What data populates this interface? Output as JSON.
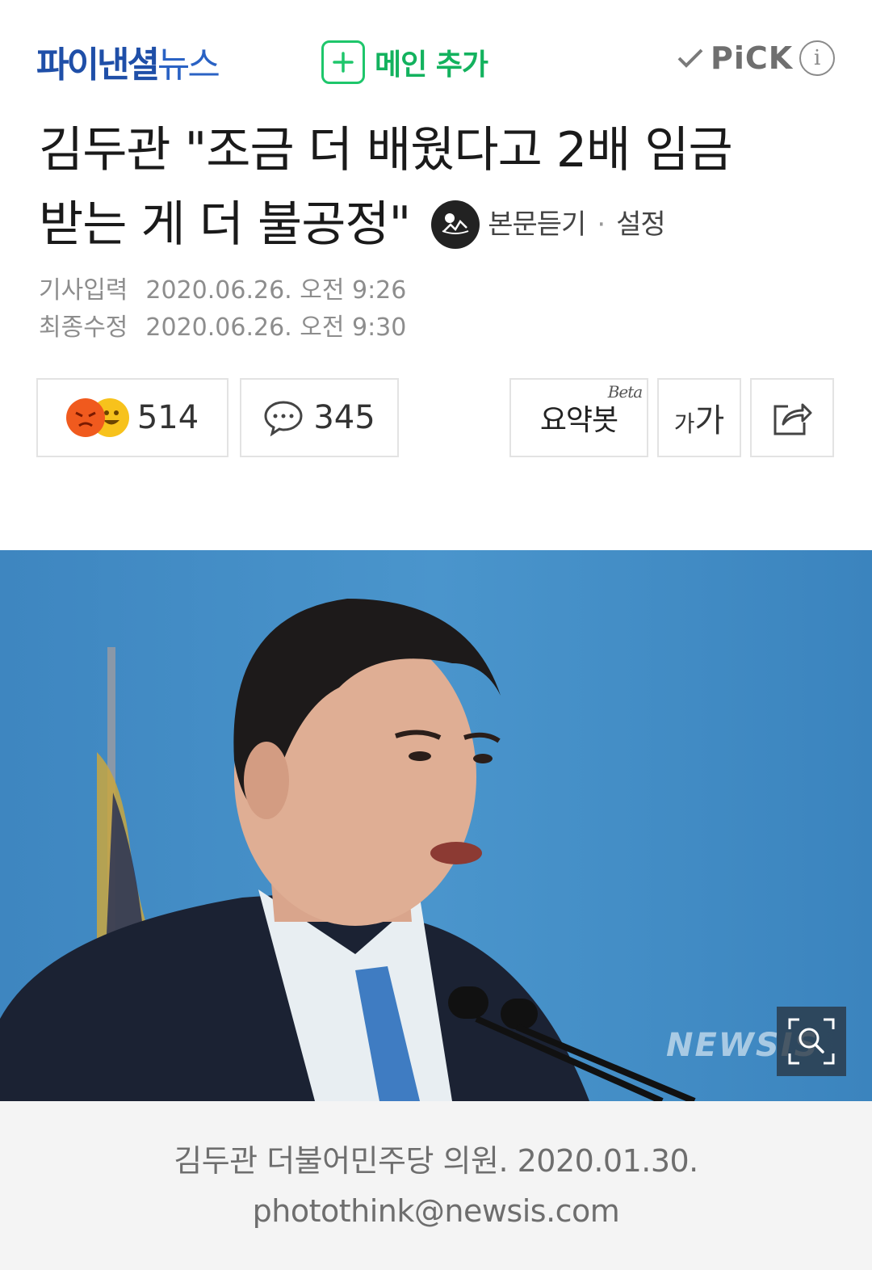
{
  "header": {
    "brand_main": "파이낸셜",
    "brand_sub": "뉴스",
    "main_add_label": "메인 추가",
    "pick_label": "PiCK",
    "info_label": "i"
  },
  "article": {
    "title_line1": "김두관 \"조금 더 배웠다고 2배 임금",
    "title_line2": "받는 게 더 불공정\"",
    "tts_label": "본문듣기",
    "tts_sep": "·",
    "settings_label": "설정",
    "input_label": "기사입력",
    "input_date": "2020.06.26. 오전 9:26",
    "modified_label": "최종수정",
    "modified_date": "2020.06.26. 오전 9:30"
  },
  "actions": {
    "reaction_count": "514",
    "comment_count": "345",
    "summary_label": "요약봇",
    "summary_badge": "Beta",
    "font_small": "가",
    "font_large": "가"
  },
  "photo": {
    "watermark": "NEWSIS",
    "caption": "김두관 더불어민주당 의원. 2020.01.30. photothink@newsis.com"
  },
  "colors": {
    "brand": "#1f4fa8",
    "main_add": "#13b25e",
    "photo_bg": "#3c86c2"
  }
}
